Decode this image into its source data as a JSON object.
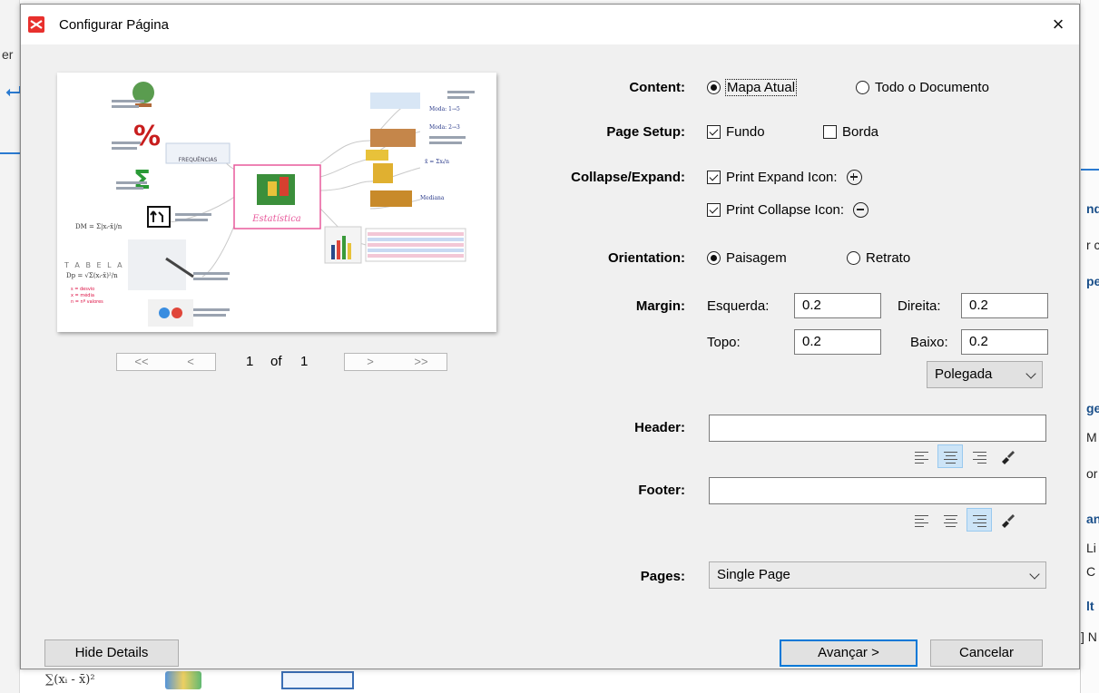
{
  "dialog": {
    "title": "Configurar Página",
    "close": "×"
  },
  "preview": {
    "central_topic": "Estatística",
    "branch_label": "FREQUÊNCIAS"
  },
  "pager": {
    "first": "<<",
    "prev": "<",
    "current": "1",
    "of": "of",
    "total": "1",
    "next": ">",
    "last": ">>"
  },
  "content": {
    "label": "Content:",
    "option1": "Mapa Atual",
    "option2": "Todo o Documento",
    "selected": "Mapa Atual"
  },
  "page_setup": {
    "label": "Page Setup:",
    "fundo": "Fundo",
    "fundo_checked": true,
    "borda": "Borda",
    "borda_checked": false
  },
  "collapse_expand": {
    "label": "Collapse/Expand:",
    "expand": "Print Expand Icon:",
    "expand_checked": true,
    "collapse": "Print Collapse Icon:",
    "collapse_checked": true
  },
  "orientation": {
    "label": "Orientation:",
    "option1": "Paisagem",
    "option2": "Retrato",
    "selected": "Paisagem"
  },
  "margin": {
    "label": "Margin:",
    "left_label": "Esquerda:",
    "left": "0.2",
    "right_label": "Direita:",
    "right": "0.2",
    "top_label": "Topo:",
    "top": "0.2",
    "bottom_label": "Baixo:",
    "bottom": "0.2",
    "unit": "Polegada"
  },
  "header": {
    "label": "Header:",
    "value": "",
    "alignment": "center"
  },
  "footer": {
    "label": "Footer:",
    "value": "",
    "alignment": "right"
  },
  "pages": {
    "label": "Pages:",
    "value": "Single Page"
  },
  "buttons": {
    "hide_details": "Hide Details",
    "next": "Avançar >",
    "cancel": "Cancelar"
  },
  "background": {
    "left_fragment": "er",
    "right_fragments": [
      "nd",
      "r c",
      "pe",
      "ge",
      "M",
      "or",
      "an",
      "Li",
      "C",
      "lt",
      "] N"
    ],
    "formula": "∑(xᵢ - x̄)²"
  },
  "colors": {
    "accent": "#0078d7",
    "selected_align": "#cce4f7",
    "app_icon": "#e8302d",
    "central_topic_border": "#e85a9c"
  }
}
